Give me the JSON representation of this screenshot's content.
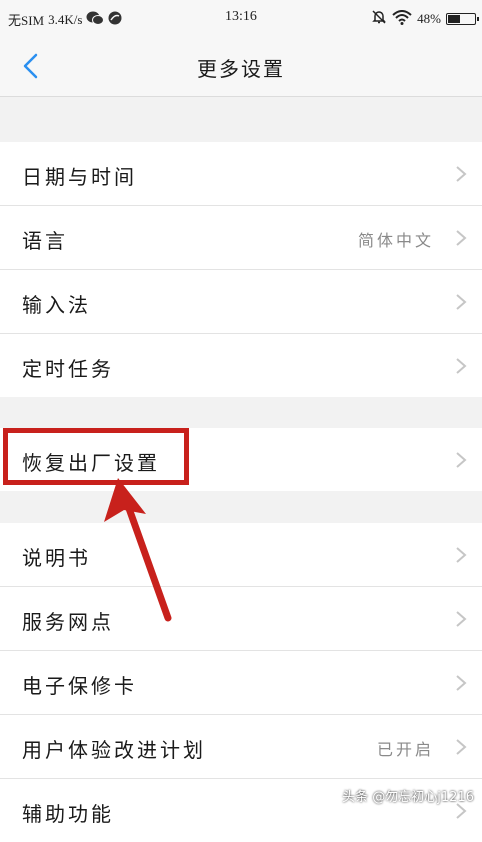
{
  "status_bar": {
    "carrier": "无SIM",
    "speed": "3.4K/s",
    "time": "13:16",
    "battery_text": "48%",
    "battery_level": 0.48
  },
  "header": {
    "title": "更多设置"
  },
  "groups": [
    {
      "items": [
        {
          "label": "日期与时间",
          "value": ""
        },
        {
          "label": "语言",
          "value": "简体中文"
        },
        {
          "label": "输入法",
          "value": ""
        },
        {
          "label": "定时任务",
          "value": ""
        }
      ]
    },
    {
      "items": [
        {
          "label": "恢复出厂设置",
          "value": ""
        }
      ]
    },
    {
      "items": [
        {
          "label": "说明书",
          "value": ""
        },
        {
          "label": "服务网点",
          "value": ""
        },
        {
          "label": "电子保修卡",
          "value": ""
        },
        {
          "label": "用户体验改进计划",
          "value": "已开启"
        },
        {
          "label": "辅助功能",
          "value": ""
        }
      ]
    }
  ],
  "annotation": {
    "color": "#c8211c",
    "target": "恢复出厂设置"
  },
  "watermark": "头条 @勿忘初心j1216"
}
